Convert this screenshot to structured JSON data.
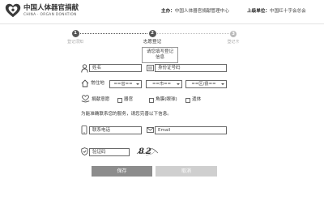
{
  "header": {
    "logo_title": "中国人体器官捐献",
    "logo_subtitle": "CHINA · ORGAN DONATION",
    "sponsor_label": "主办：",
    "sponsor_name": "中国人体器官捐献管理中心",
    "parent_label": "上级单位：",
    "parent_name": "中国红十字会总会"
  },
  "steps": [
    {
      "number": "1",
      "label": "登记须知"
    },
    {
      "number": "2",
      "label": "志愿登记"
    },
    {
      "number": "3",
      "label": "登记卡"
    }
  ],
  "current_step": 2,
  "step_hint": "请您填写登记信息",
  "form": {
    "name": {
      "placeholder": "姓名",
      "value": ""
    },
    "id_number": {
      "placeholder": "身份证号码",
      "value": ""
    },
    "residence": {
      "label": "常住地",
      "province": "==省==",
      "city": "==市==",
      "district": "==区/县=="
    },
    "donation": {
      "label": "捐献意愿",
      "options": [
        {
          "label": "器官",
          "checked": false
        },
        {
          "label": "角膜(眼球)",
          "checked": false
        },
        {
          "label": "遗体",
          "checked": false
        }
      ]
    },
    "contact_note": "为能准确联系您的服务，请您完善以下信息。",
    "phone": {
      "placeholder": "联系电话",
      "value": ""
    },
    "email": {
      "placeholder": "Email",
      "value": ""
    },
    "captcha": {
      "placeholder": "验证码",
      "value": "",
      "image_text": "82"
    }
  },
  "buttons": {
    "save": "保存",
    "cancel": "取消"
  },
  "icons": {
    "logo": "organ-donation-heart-logo",
    "name": "person-icon",
    "id_number": "id-card-icon",
    "residence": "house-icon",
    "donation": "heart-hand-icon",
    "phone": "phone-icon",
    "email": "envelope-icon",
    "captcha": "shield-check-icon",
    "select": "chevron-down-icon"
  },
  "colors": {
    "step_active": "#555555",
    "step_pending": "#bbbbbb",
    "save_button": "#8c8c8c",
    "cancel_button": "#cfcfcf"
  }
}
